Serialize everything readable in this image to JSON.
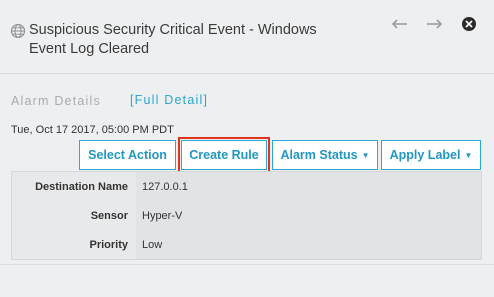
{
  "header": {
    "title": "Suspicious Security Critical Event - Windows Event Log Cleared",
    "prev_icon": "arrow-left-icon",
    "next_icon": "arrow-right-icon",
    "close_icon": "close-circle-icon"
  },
  "alarm_details": {
    "label": "Alarm Details",
    "full_detail_link": "[Full Detail]",
    "timestamp": "Tue, Oct 17 2017, 05:00 PM PDT"
  },
  "actions": {
    "select_action": "Select Action",
    "create_rule": "Create Rule",
    "alarm_status": "Alarm Status",
    "apply_label": "Apply Label"
  },
  "details": [
    {
      "key": "Destination Name",
      "value": "127.0.0.1"
    },
    {
      "key": "Sensor",
      "value": "Hyper-V"
    },
    {
      "key": "Priority",
      "value": "Low"
    }
  ],
  "colors": {
    "accent": "#29a9d4",
    "highlight": "#e0341e",
    "background": "#eeeff0"
  }
}
